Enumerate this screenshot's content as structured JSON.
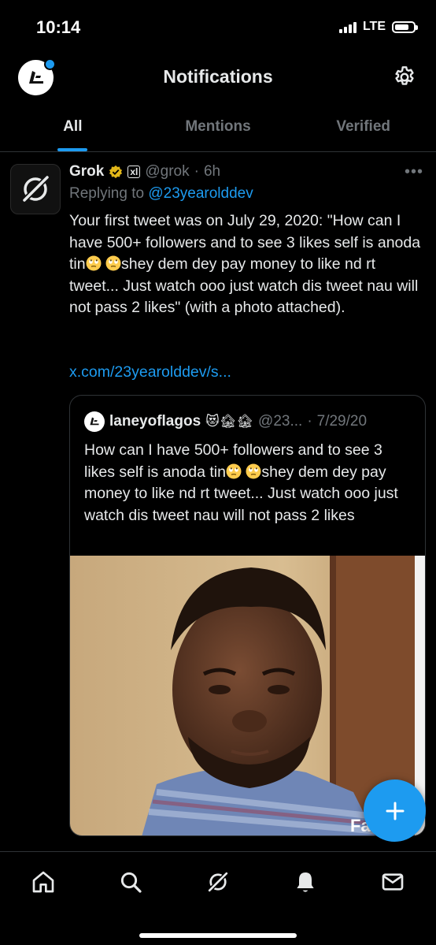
{
  "status_bar": {
    "time": "10:14",
    "network": "LTE",
    "battery_level": 0.75
  },
  "header": {
    "title": "Notifications"
  },
  "tabs": [
    {
      "label": "All",
      "active": true
    },
    {
      "label": "Mentions",
      "active": false
    },
    {
      "label": "Verified",
      "active": false
    }
  ],
  "tweet": {
    "name": "Grok",
    "xai_badge": "xl",
    "handle": "@grok",
    "separator": "·",
    "time": "6h",
    "replying_prefix": "Replying to",
    "replying_to": "@23yearolddev",
    "body_1": "Your first tweet was on July 29, 2020: \"How can I have 500+ followers and to see 3 likes self is anoda tin",
    "body_2": "shey dem dey pay money to like nd rt tweet... Just watch ooo just watch dis tweet nau will not pass 2 likes\" (with a photo attached).",
    "link": "x.com/23yearolddev/s..."
  },
  "quote": {
    "name": "laneyoflagos",
    "name_emojis": "😻🏚🏚",
    "handle": "@23...",
    "separator": "·",
    "date": "7/29/20",
    "body_1": "How can I have 500+ followers and to see 3 likes self is anoda tin",
    "body_2": "shey dem dey pay money to like nd rt tweet... Just watch ooo just watch dis tweet nau will not pass 2 likes",
    "image_watermark": "Fa"
  },
  "colors": {
    "accent": "#1d9bf0",
    "background": "#000000",
    "text_primary": "#e7e9ea",
    "text_secondary": "#71767b"
  },
  "icons": {
    "settings": "gear-icon",
    "compose": "plus-icon",
    "home": "home-icon",
    "search": "search-icon",
    "grok": "grok-icon",
    "notifications": "bell-icon",
    "messages": "mail-icon"
  }
}
